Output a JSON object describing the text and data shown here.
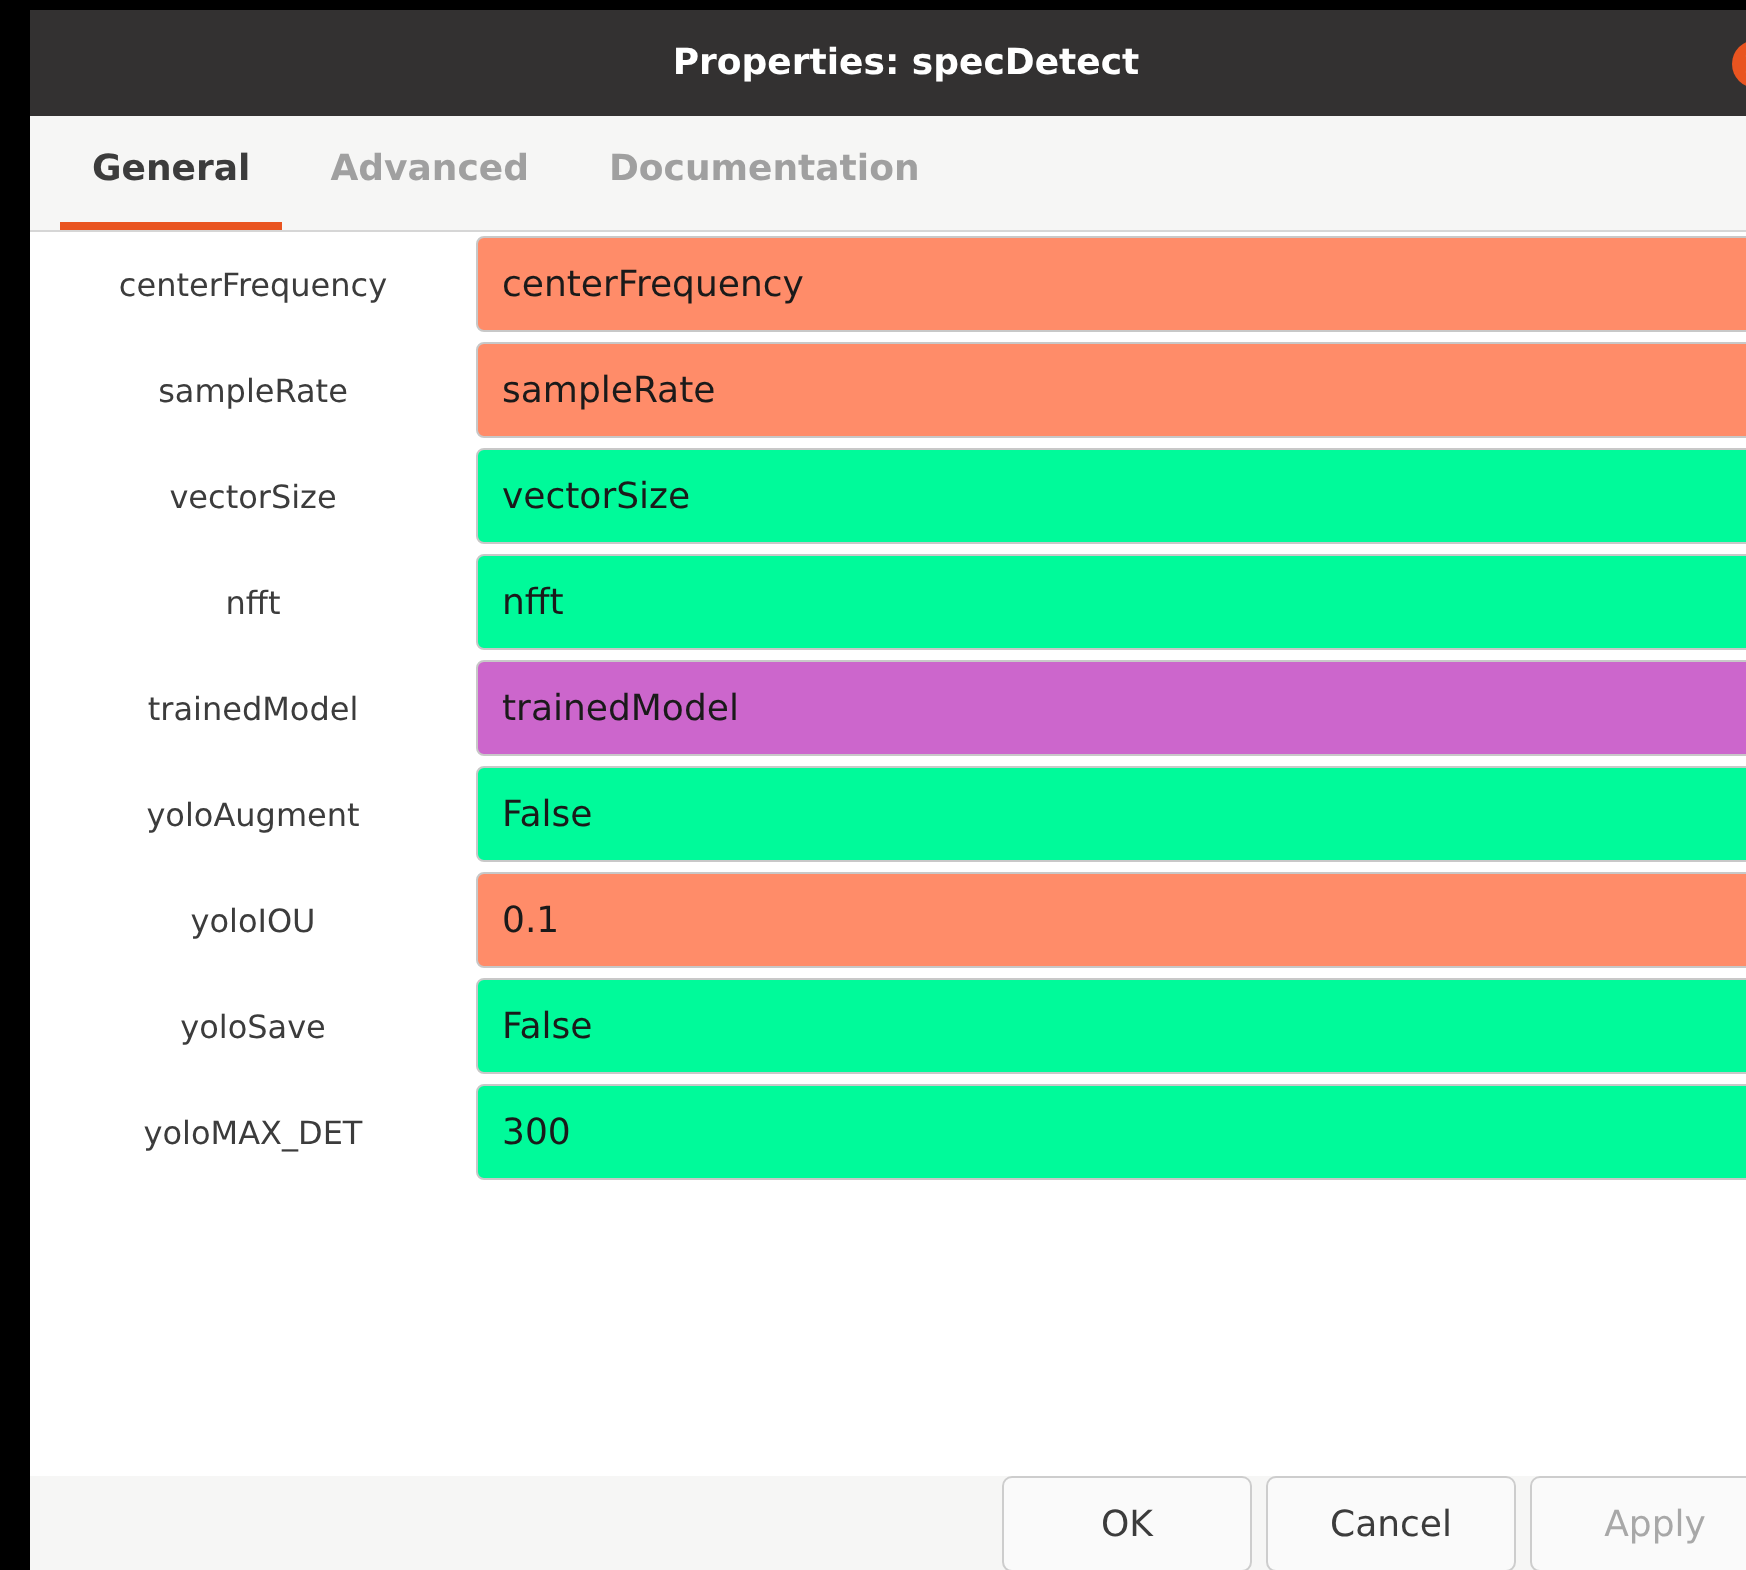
{
  "window": {
    "title": "Properties: specDetect"
  },
  "tabs": [
    {
      "label": "General",
      "selected": true
    },
    {
      "label": "Advanced",
      "selected": false
    },
    {
      "label": "Documentation",
      "selected": false
    }
  ],
  "fields": [
    {
      "label": "centerFrequency",
      "value": "centerFrequency",
      "color": "#ff8c69"
    },
    {
      "label": "sampleRate",
      "value": "sampleRate",
      "color": "#ff8c69"
    },
    {
      "label": "vectorSize",
      "value": "vectorSize",
      "color": "#00fa9a"
    },
    {
      "label": "nfft",
      "value": "nfft",
      "color": "#00fa9a"
    },
    {
      "label": "trainedModel",
      "value": "trainedModel",
      "color": "#cc66cc"
    },
    {
      "label": "yoloAugment",
      "value": "False",
      "color": "#00fa9a"
    },
    {
      "label": "yoloIOU",
      "value": "0.1",
      "color": "#ff8c69"
    },
    {
      "label": "yoloSave",
      "value": "False",
      "color": "#00fa9a"
    },
    {
      "label": "yoloMAX_DET",
      "value": "300",
      "color": "#00fa9a"
    }
  ],
  "buttons": [
    {
      "label": "OK",
      "disabled": false
    },
    {
      "label": "Cancel",
      "disabled": false
    },
    {
      "label": "Apply",
      "disabled": true
    }
  ]
}
